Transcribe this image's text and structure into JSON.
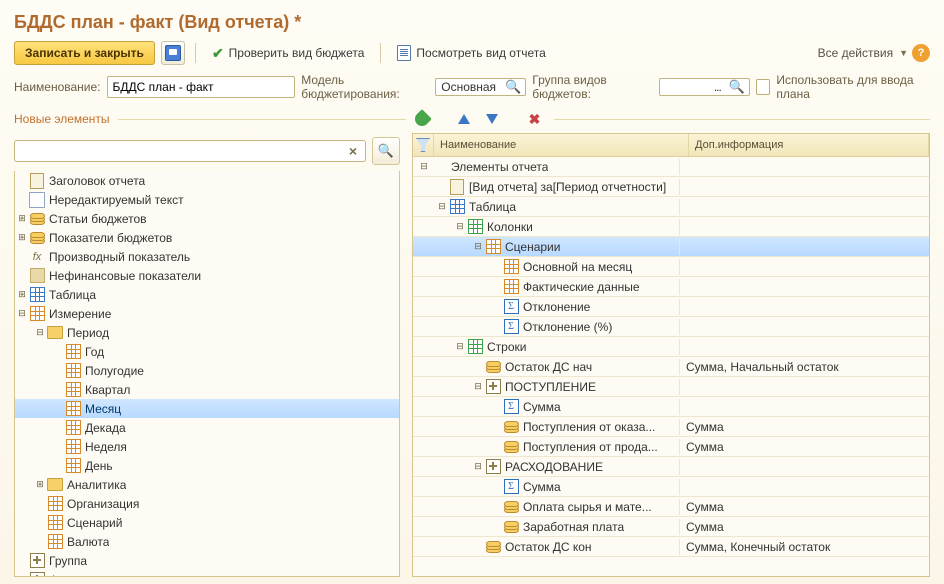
{
  "title": "БДДС план - факт (Вид отчета) *",
  "toolbar": {
    "save_close": "Записать и закрыть",
    "check_budget": "Проверить вид бюджета",
    "view_report": "Посмотреть вид отчета",
    "all_actions": "Все действия"
  },
  "fields": {
    "name_label": "Наименование:",
    "name_value": "БДДС план - факт",
    "model_label": "Модель бюджетирования:",
    "model_value": "Основная",
    "group_label": "Группа видов бюджетов:",
    "group_value": "",
    "use_for_plan": "Использовать для ввода плана"
  },
  "left": {
    "section": "Новые элементы",
    "tree": [
      {
        "d": 0,
        "exp": "",
        "ico": "page",
        "label": "Заголовок отчета"
      },
      {
        "d": 0,
        "exp": "",
        "ico": "text",
        "label": "Нередактируемый текст"
      },
      {
        "d": 0,
        "exp": "+",
        "ico": "coins",
        "label": "Статьи бюджетов"
      },
      {
        "d": 0,
        "exp": "+",
        "ico": "coins",
        "label": "Показатели бюджетов"
      },
      {
        "d": 0,
        "exp": "",
        "ico": "fx",
        "label": "Производный показатель"
      },
      {
        "d": 0,
        "exp": "",
        "ico": "square",
        "label": "Нефинансовые показатели"
      },
      {
        "d": 0,
        "exp": "+",
        "ico": "grid",
        "label": "Таблица"
      },
      {
        "d": 0,
        "exp": "-",
        "ico": "grid-o",
        "label": "Измерение"
      },
      {
        "d": 1,
        "exp": "-",
        "ico": "folder",
        "label": "Период"
      },
      {
        "d": 2,
        "exp": "",
        "ico": "grid-o",
        "label": "Год"
      },
      {
        "d": 2,
        "exp": "",
        "ico": "grid-o",
        "label": "Полугодие"
      },
      {
        "d": 2,
        "exp": "",
        "ico": "grid-o",
        "label": "Квартал"
      },
      {
        "d": 2,
        "exp": "",
        "ico": "grid-o",
        "label": "Месяц",
        "sel": true
      },
      {
        "d": 2,
        "exp": "",
        "ico": "grid-o",
        "label": "Декада"
      },
      {
        "d": 2,
        "exp": "",
        "ico": "grid-o",
        "label": "Неделя"
      },
      {
        "d": 2,
        "exp": "",
        "ico": "grid-o",
        "label": "День"
      },
      {
        "d": 1,
        "exp": "+",
        "ico": "folder",
        "label": "Аналитика"
      },
      {
        "d": 1,
        "exp": "",
        "ico": "grid-o",
        "label": "Организация"
      },
      {
        "d": 1,
        "exp": "",
        "ico": "grid-o",
        "label": "Сценарий"
      },
      {
        "d": 1,
        "exp": "",
        "ico": "grid-o",
        "label": "Валюта"
      },
      {
        "d": 0,
        "exp": "",
        "ico": "plus",
        "label": "Группа"
      },
      {
        "d": 0,
        "exp": "",
        "ico": "plus",
        "label": "Формула по группе"
      }
    ]
  },
  "right": {
    "col_name": "Наименование",
    "col_info": "Доп.информация",
    "rows": [
      {
        "d": 0,
        "exp": "-",
        "ico": "",
        "name": "Элементы отчета",
        "info": ""
      },
      {
        "d": 1,
        "exp": "",
        "ico": "page",
        "name": "[Вид отчета] за[Период отчетности]",
        "info": ""
      },
      {
        "d": 1,
        "exp": "-",
        "ico": "grid",
        "name": "Таблица",
        "info": ""
      },
      {
        "d": 2,
        "exp": "-",
        "ico": "grid-g",
        "name": "Колонки",
        "info": ""
      },
      {
        "d": 3,
        "exp": "-",
        "ico": "grid-o",
        "name": "Сценарии",
        "info": "",
        "sel": true
      },
      {
        "d": 4,
        "exp": "",
        "ico": "grid-o",
        "name": "Основной на месяц",
        "info": ""
      },
      {
        "d": 4,
        "exp": "",
        "ico": "grid-o",
        "name": "Фактические данные",
        "info": ""
      },
      {
        "d": 4,
        "exp": "",
        "ico": "sigma",
        "name": "Отклонение",
        "info": ""
      },
      {
        "d": 4,
        "exp": "",
        "ico": "sigma",
        "name": "Отклонение (%)",
        "info": ""
      },
      {
        "d": 2,
        "exp": "-",
        "ico": "grid-g",
        "name": "Строки",
        "info": ""
      },
      {
        "d": 3,
        "exp": "",
        "ico": "coins",
        "name": "Остаток ДС нач",
        "info": "Сумма, Начальный остаток"
      },
      {
        "d": 3,
        "exp": "-",
        "ico": "plus",
        "name": "ПОСТУПЛЕНИЕ",
        "info": ""
      },
      {
        "d": 4,
        "exp": "",
        "ico": "sigma",
        "name": "Сумма",
        "info": ""
      },
      {
        "d": 4,
        "exp": "",
        "ico": "coins",
        "name": "Поступления от оказа...",
        "info": "Сумма"
      },
      {
        "d": 4,
        "exp": "",
        "ico": "coins",
        "name": "Поступления от прода...",
        "info": "Сумма"
      },
      {
        "d": 3,
        "exp": "-",
        "ico": "plus",
        "name": "РАСХОДОВАНИЕ",
        "info": ""
      },
      {
        "d": 4,
        "exp": "",
        "ico": "sigma",
        "name": "Сумма",
        "info": ""
      },
      {
        "d": 4,
        "exp": "",
        "ico": "coins",
        "name": "Оплата сырья и мате...",
        "info": "Сумма"
      },
      {
        "d": 4,
        "exp": "",
        "ico": "coins",
        "name": "Заработная плата",
        "info": "Сумма"
      },
      {
        "d": 3,
        "exp": "",
        "ico": "coins",
        "name": "Остаток ДС кон",
        "info": "Сумма, Конечный остаток"
      }
    ]
  }
}
